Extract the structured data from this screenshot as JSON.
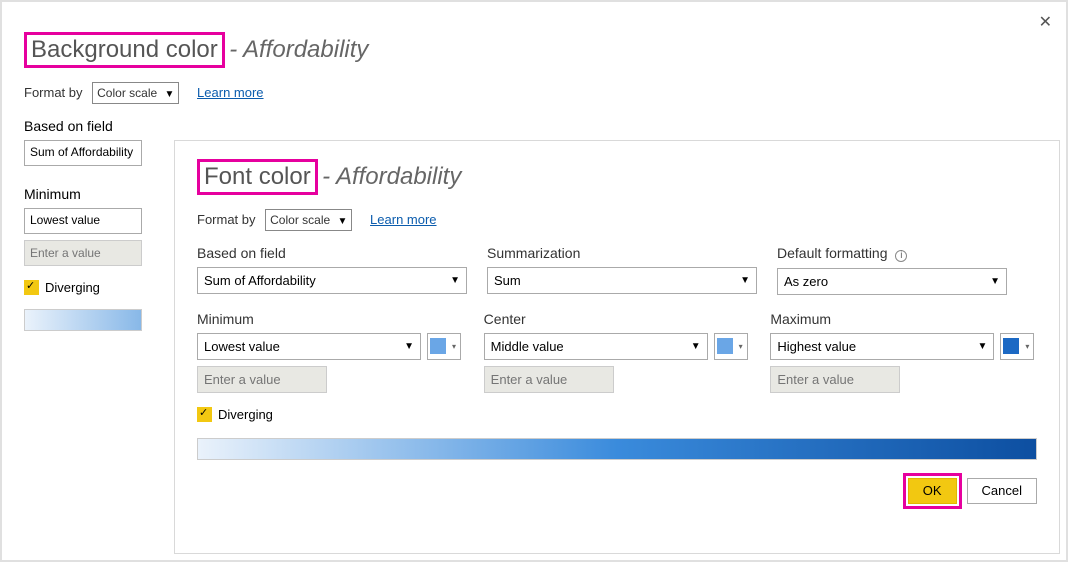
{
  "close_icon": "✕",
  "bg_dialog": {
    "title": "Background color",
    "subtitle": "- Affordability",
    "format_by_label": "Format by",
    "format_by_value": "Color scale",
    "learn_more": "Learn more",
    "based_on_field_label": "Based on field",
    "based_on_field_value": "Sum of Affordability",
    "minimum_label": "Minimum",
    "minimum_value": "Lowest value",
    "enter_value_placeholder": "Enter a value",
    "diverging_label": "Diverging"
  },
  "fc_dialog": {
    "title": "Font color",
    "subtitle": "- Affordability",
    "format_by_label": "Format by",
    "format_by_value": "Color scale",
    "learn_more": "Learn more",
    "based_on_field_label": "Based on field",
    "based_on_field_value": "Sum of Affordability",
    "summarization_label": "Summarization",
    "summarization_value": "Sum",
    "default_fmt_label": "Default formatting",
    "default_fmt_value": "As zero",
    "minimum": {
      "label": "Minimum",
      "value": "Lowest value",
      "placeholder": "Enter a value",
      "color": "#6aa6e6"
    },
    "center": {
      "label": "Center",
      "value": "Middle value",
      "placeholder": "Enter a value",
      "color": "#6aa6e6"
    },
    "maximum": {
      "label": "Maximum",
      "value": "Highest value",
      "placeholder": "Enter a value",
      "color": "#1c69c4"
    },
    "diverging_label": "Diverging",
    "ok_label": "OK",
    "cancel_label": "Cancel",
    "gradient": [
      "#eaf2fb",
      "#3a8bdc",
      "#0d4fa1"
    ]
  }
}
